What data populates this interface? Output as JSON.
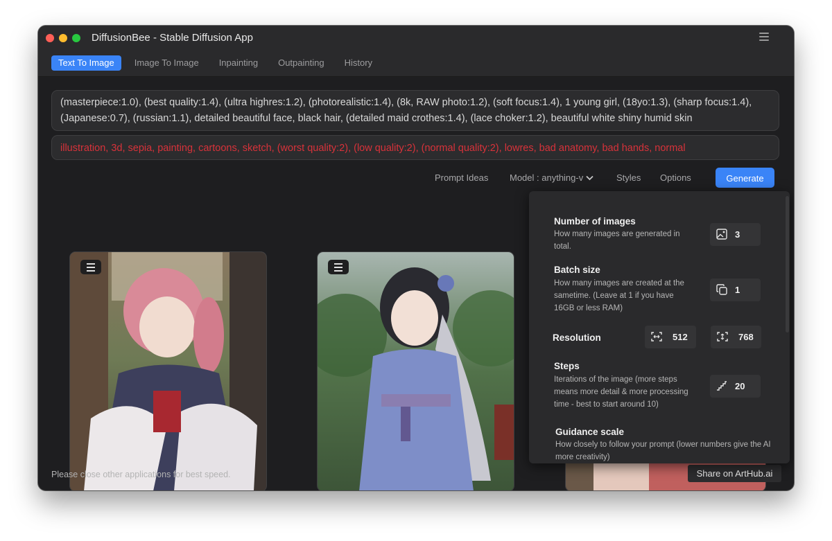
{
  "window": {
    "title": "DiffusionBee - Stable Diffusion App"
  },
  "tabs": [
    {
      "label": "Text To Image",
      "active": true
    },
    {
      "label": "Image To Image",
      "active": false
    },
    {
      "label": "Inpainting",
      "active": false
    },
    {
      "label": "Outpainting",
      "active": false
    },
    {
      "label": "History",
      "active": false
    }
  ],
  "prompt": {
    "text": "(masterpiece:1.0), (best quality:1.4), (ultra highres:1.2), (photorealistic:1.4), (8k, RAW photo:1.2), (soft focus:1.4), 1 young girl, (18yo:1.3), (sharp focus:1.4), (Japanese:0.7), (russian:1.1), detailed beautiful face, black hair, (detailed maid crothes:1.4), (lace choker:1.2), beautiful white shiny humid skin"
  },
  "negative_prompt": {
    "text": "illustration, 3d, sepia, painting, cartoons, sketch, (worst quality:2), (low quality:2), (normal quality:2), lowres, bad anatomy, bad hands, normal"
  },
  "toolbar": {
    "prompt_ideas": "Prompt Ideas",
    "model": "Model : anything-v",
    "styles": "Styles",
    "options": "Options",
    "generate": "Generate"
  },
  "options_panel": {
    "num_images": {
      "title": "Number of images",
      "desc": "How many images are generated in total.",
      "value": "3"
    },
    "batch_size": {
      "title": "Batch size",
      "desc": "How many images are created at the sametime. (Leave at 1 if you have 16GB or less RAM)",
      "value": "1"
    },
    "resolution": {
      "title": "Resolution",
      "width": "512",
      "height": "768"
    },
    "steps": {
      "title": "Steps",
      "desc": "Iterations of the image (more steps means more detail & more processing time - best to start around 10)",
      "value": "20"
    },
    "guidance": {
      "title": "Guidance scale",
      "desc": "How closely to follow your prompt (lower numbers give the AI more creativity)"
    }
  },
  "status": {
    "text": "Please close other applications for best speed."
  },
  "share": {
    "label": "Share on ArtHub.ai"
  },
  "icons": [
    "menu-icon",
    "image-icon",
    "copy-icon",
    "resize-width-icon",
    "resize-height-icon",
    "steps-icon",
    "chevron-down-icon"
  ],
  "colors": {
    "accent": "#3a84f7",
    "negative_text": "#d8323a",
    "window_bg": "#1e1e20"
  }
}
